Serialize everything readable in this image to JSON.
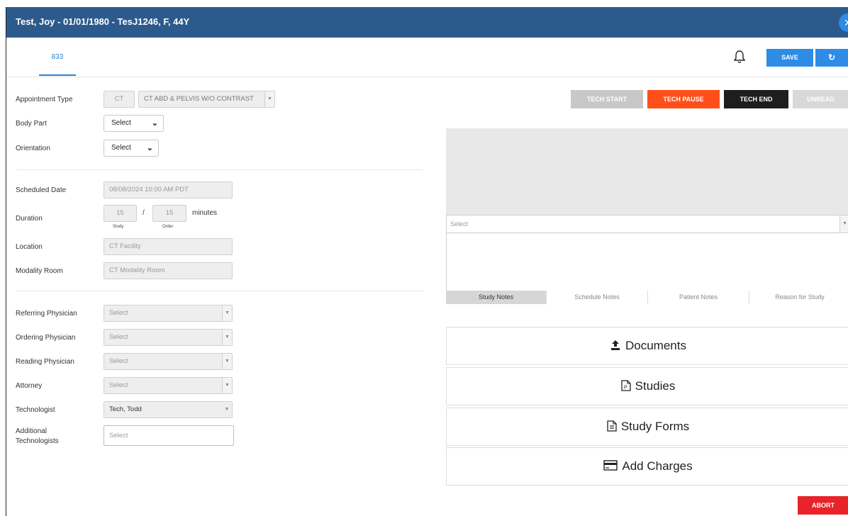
{
  "header": {
    "title": "Test, Joy - 01/01/1980 - TesJ1246, F, 44Y",
    "close_icon": "close-icon"
  },
  "tabs": [
    {
      "label": "833",
      "active": true
    }
  ],
  "toolbar": {
    "save_label": "SAVE",
    "refresh_icon": "refresh-icon",
    "bell_icon": "bell-icon"
  },
  "form": {
    "appointment_type": {
      "label": "Appointment Type",
      "code": "CT",
      "value": "CT ABD & PELVIS W/O CONTRAST"
    },
    "body_part": {
      "label": "Body Part",
      "value": "Select"
    },
    "orientation": {
      "label": "Orientation",
      "value": "Select"
    },
    "scheduled_date": {
      "label": "Scheduled Date",
      "value": "08/08/2024 10:00 AM PDT"
    },
    "duration": {
      "label": "Duration",
      "study": "15",
      "separator": "/",
      "order": "15",
      "unit": "minutes",
      "study_caption": "Study",
      "order_caption": "Order"
    },
    "location": {
      "label": "Location",
      "value": "CT Facility"
    },
    "modality_room": {
      "label": "Modality Room",
      "value": "CT Modality Room"
    },
    "referring_physician": {
      "label": "Referring Physician",
      "placeholder": "Select"
    },
    "ordering_physician": {
      "label": "Ordering Physician",
      "placeholder": "Select"
    },
    "reading_physician": {
      "label": "Reading Physician",
      "placeholder": "Select"
    },
    "attorney": {
      "label": "Attorney",
      "placeholder": "Select"
    },
    "technologist": {
      "label": "Technologist",
      "value": "Tech, Todd"
    },
    "additional_technologists": {
      "label_line1": "Additional",
      "label_line2": "Technologists",
      "placeholder": "Select"
    }
  },
  "tech_buttons": {
    "start": "TECH START",
    "pause": "TECH PAUSE",
    "end": "TECH END",
    "unread": "UNREAD"
  },
  "colors": {
    "header": "#2d5a8c",
    "accent": "#2e8be6",
    "pause": "#ff4f19",
    "end": "#1e1e1e",
    "disabled": "#c8c8c8",
    "abort": "#e8232a"
  },
  "notes": {
    "select_placeholder": "Select",
    "tabs": [
      "Study Notes",
      "Schedule Notes",
      "Patient Notes",
      "Reason for Study"
    ]
  },
  "sections": [
    {
      "label": "Documents",
      "icon": "upload-icon"
    },
    {
      "label": "Studies",
      "icon": "pdf-file-icon"
    },
    {
      "label": "Study Forms",
      "icon": "form-file-icon"
    },
    {
      "label": "Add Charges",
      "icon": "credit-card-icon"
    }
  ],
  "abort_label": "ABORT"
}
